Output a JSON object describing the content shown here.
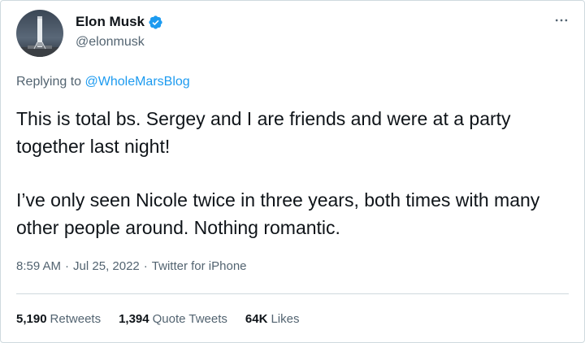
{
  "author": {
    "name": "Elon Musk",
    "handle": "@elonmusk",
    "verified": true,
    "avatar_icon": "rocket-launchpad-avatar"
  },
  "reply_context": {
    "prefix": "Replying to",
    "target": "@WholeMarsBlog"
  },
  "tweet": {
    "paragraphs": [
      "This is total bs. Sergey and I are friends and were at a party together last night!",
      "I’ve only seen Nicole twice in three years, both times with many other people around. Nothing romantic."
    ]
  },
  "meta": {
    "time": "8:59 AM",
    "separator": "·",
    "date": "Jul 25, 2022",
    "source": "Twitter for iPhone"
  },
  "stats": {
    "retweets_count": "5,190",
    "retweets_label": "Retweets",
    "quotes_count": "1,394",
    "quotes_label": "Quote Tweets",
    "likes_count": "64K",
    "likes_label": "Likes"
  },
  "colors": {
    "accent": "#1d9bf0",
    "text_primary": "#0f1419",
    "text_secondary": "#536471",
    "border": "#cfd9de"
  },
  "icons": {
    "verified": "verified-badge-icon",
    "more": "more-horizontal-icon"
  }
}
